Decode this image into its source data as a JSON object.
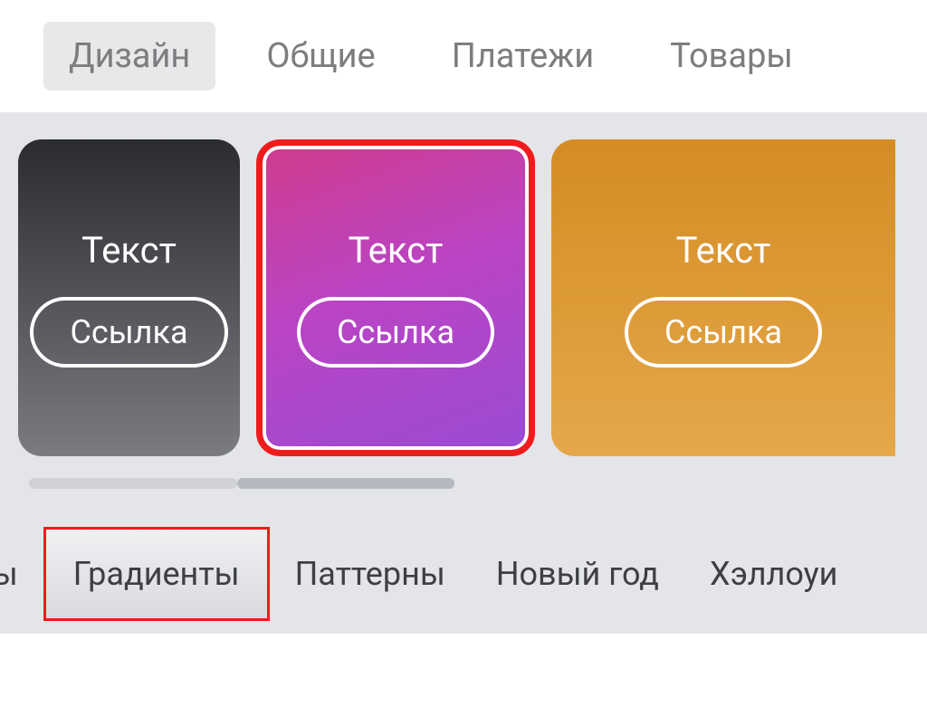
{
  "topTabs": [
    {
      "label": "Дизайн",
      "active": true
    },
    {
      "label": "Общие",
      "active": false
    },
    {
      "label": "Платежи",
      "active": false
    },
    {
      "label": "Товары",
      "active": false
    }
  ],
  "cards": [
    {
      "text": "Текст",
      "link": "Ссылка"
    },
    {
      "text": "Текст",
      "link": "Ссылка"
    },
    {
      "text": "Текст",
      "link": "Ссылка"
    }
  ],
  "bottomTabs": [
    {
      "label": "емы",
      "highlighted": false
    },
    {
      "label": "Градиенты",
      "highlighted": true
    },
    {
      "label": "Паттерны",
      "highlighted": false
    },
    {
      "label": "Новый год",
      "highlighted": false
    },
    {
      "label": "Хэллоуи",
      "highlighted": false
    }
  ]
}
